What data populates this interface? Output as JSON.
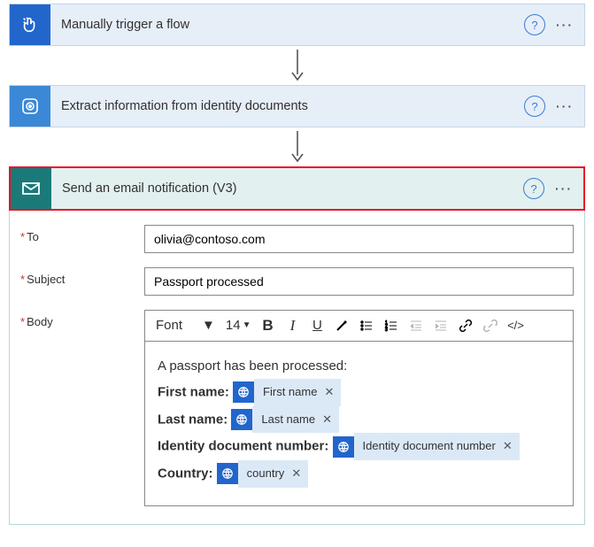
{
  "steps": {
    "s1": {
      "label": "Manually trigger a flow"
    },
    "s2": {
      "label": "Extract information from identity documents"
    },
    "s3": {
      "label": "Send an email notification (V3)"
    }
  },
  "form": {
    "to_label": "To",
    "to_value": "olivia@contoso.com",
    "subject_label": "Subject",
    "subject_value": "Passport processed",
    "body_label": "Body"
  },
  "toolbar": {
    "font": "Font",
    "size": "14"
  },
  "body_content": {
    "intro": "A passport has been processed:",
    "l1_label": "First name:",
    "l1_token": "First name",
    "l2_label": "Last name:",
    "l2_token": "Last name",
    "l3_label": "Identity document number:",
    "l3_token": "Identity document number",
    "l4_label": "Country:",
    "l4_token": "country"
  }
}
